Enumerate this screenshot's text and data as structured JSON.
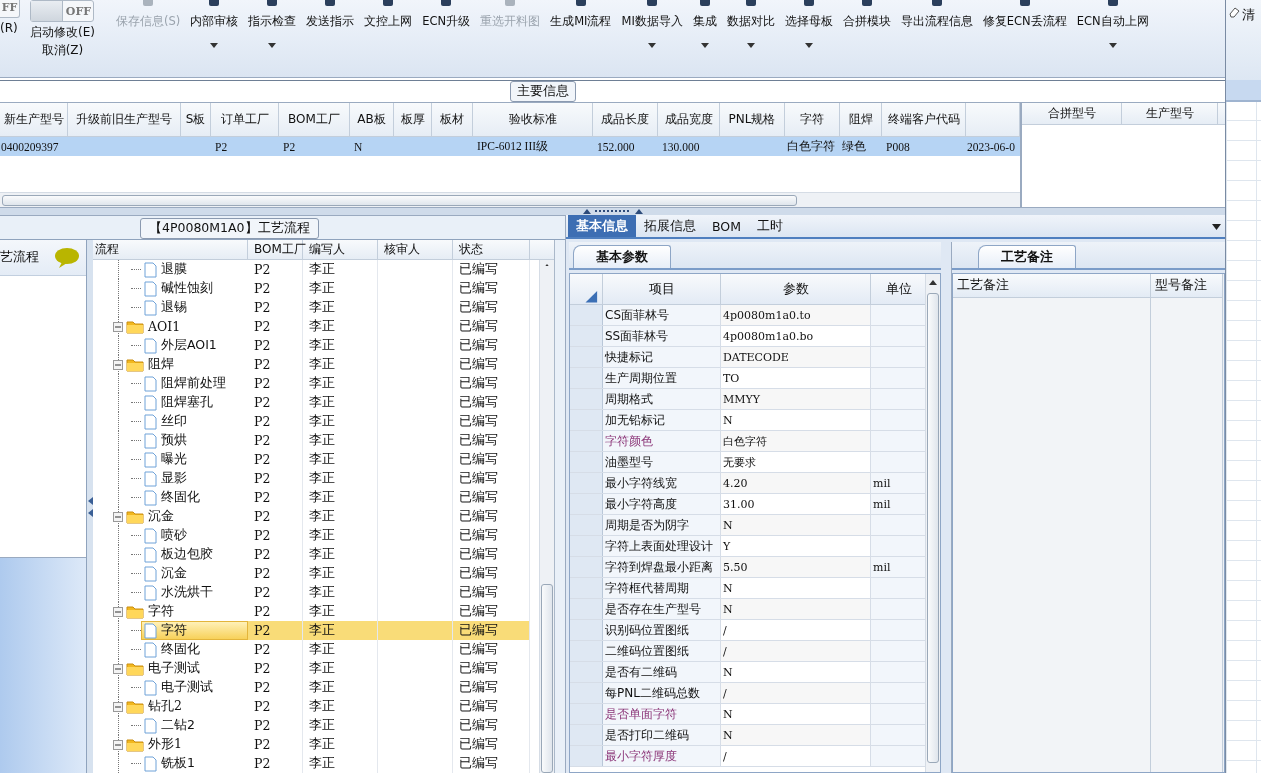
{
  "ribbon": {
    "toggles": [
      {
        "switch": "FF",
        "on": false,
        "labels": [
          "(R)"
        ]
      },
      {
        "switch": "OFF",
        "on": false,
        "labels": [
          "启动修改(E)",
          "取消(Z)"
        ]
      }
    ],
    "buttons": [
      {
        "label": "保存信息(S)",
        "disabled": true,
        "dropdown": false
      },
      {
        "label": "内部审核",
        "disabled": false,
        "dropdown": true
      },
      {
        "label": "指示检查",
        "disabled": false,
        "dropdown": true
      },
      {
        "label": "发送指示",
        "disabled": false,
        "dropdown": false
      },
      {
        "label": "文控上网",
        "disabled": false,
        "dropdown": false
      },
      {
        "label": "ECN升级",
        "disabled": false,
        "dropdown": false
      },
      {
        "label": "重选开料图",
        "disabled": true,
        "dropdown": false
      },
      {
        "label": "生成MI流程",
        "disabled": false,
        "dropdown": false
      },
      {
        "label": "MI数据导入",
        "disabled": false,
        "dropdown": true
      },
      {
        "label": "集成",
        "disabled": false,
        "dropdown": true
      },
      {
        "label": "数据对比",
        "disabled": false,
        "dropdown": true
      },
      {
        "label": "选择母板",
        "disabled": false,
        "dropdown": true
      },
      {
        "label": "合拼模块",
        "disabled": false,
        "dropdown": false
      },
      {
        "label": "导出流程信息",
        "disabled": false,
        "dropdown": false
      },
      {
        "label": "修复ECN丢流程",
        "disabled": false,
        "dropdown": false
      },
      {
        "label": "ECN自动上网",
        "disabled": false,
        "dropdown": true
      }
    ]
  },
  "side_strip": {
    "label": "清"
  },
  "main_info": {
    "title": "主要信息",
    "columns": [
      "新生产型号",
      "升级前旧生产型号",
      "S板",
      "订单工厂",
      "BOM工厂",
      "AB板",
      "板厚",
      "板材",
      "验收标准",
      "成品长度",
      "成品宽度",
      "PNL规格",
      "字符",
      "阻焊",
      "终端客户代码",
      null
    ],
    "rows": [
      {
        "selected": true,
        "cells": [
          "0400209397",
          null,
          null,
          "P2",
          "P2",
          "N",
          null,
          null,
          "IPC-6012 III级",
          "152.000",
          "130.000",
          null,
          "白色字符",
          "绿色",
          "P008",
          "2023-06-0"
        ]
      }
    ],
    "merge_table": {
      "columns": [
        "合拼型号",
        "生产型号"
      ]
    }
  },
  "process": {
    "title": "【4P0080M1A0】工艺流程",
    "sidebar": {
      "items": [
        {
          "label": "艺流程"
        }
      ]
    },
    "tree": {
      "columns": [
        "流程",
        "BOM工厂",
        "编写人",
        "核审人",
        "状态"
      ],
      "nodes": [
        {
          "children": [
            {
              "name": "退膜",
              "bom": "P2",
              "author": "李正",
              "status": "已编写",
              "selected": false
            },
            {
              "name": "碱性蚀刻",
              "bom": "P2",
              "author": "李正",
              "status": "已编写",
              "selected": false
            },
            {
              "name": "退锡",
              "bom": "P2",
              "author": "李正",
              "status": "已编写",
              "selected": false
            }
          ]
        },
        {
          "name": "AOI1",
          "bom": "P2",
          "author": "李正",
          "status": "已编写",
          "selected": false,
          "expanded": true,
          "children": [
            {
              "name": "外层AOI1",
              "bom": "P2",
              "author": "李正",
              "status": "已编写",
              "selected": false
            }
          ]
        },
        {
          "name": "阻焊",
          "bom": "P2",
          "author": "李正",
          "status": "已编写",
          "selected": false,
          "expanded": true,
          "children": [
            {
              "name": "阻焊前处理",
              "bom": "P2",
              "author": "李正",
              "status": "已编写",
              "selected": false
            },
            {
              "name": "阻焊塞孔",
              "bom": "P2",
              "author": "李正",
              "status": "已编写",
              "selected": false
            },
            {
              "name": "丝印",
              "bom": "P2",
              "author": "李正",
              "status": "已编写",
              "selected": false
            },
            {
              "name": "预烘",
              "bom": "P2",
              "author": "李正",
              "status": "已编写",
              "selected": false
            },
            {
              "name": "曝光",
              "bom": "P2",
              "author": "李正",
              "status": "已编写",
              "selected": false
            },
            {
              "name": "显影",
              "bom": "P2",
              "author": "李正",
              "status": "已编写",
              "selected": false
            },
            {
              "name": "终固化",
              "bom": "P2",
              "author": "李正",
              "status": "已编写",
              "selected": false
            }
          ]
        },
        {
          "name": "沉金",
          "bom": "P2",
          "author": "李正",
          "status": "已编写",
          "selected": false,
          "expanded": true,
          "children": [
            {
              "name": "喷砂",
              "bom": "P2",
              "author": "李正",
              "status": "已编写",
              "selected": false
            },
            {
              "name": "板边包胶",
              "bom": "P2",
              "author": "李正",
              "status": "已编写",
              "selected": false
            },
            {
              "name": "沉金",
              "bom": "P2",
              "author": "李正",
              "status": "已编写",
              "selected": false
            },
            {
              "name": "水洗烘干",
              "bom": "P2",
              "author": "李正",
              "status": "已编写",
              "selected": false
            }
          ]
        },
        {
          "name": "字符",
          "bom": "P2",
          "author": "李正",
          "status": "已编写",
          "selected": false,
          "expanded": true,
          "children": [
            {
              "name": "字符",
              "bom": "P2",
              "author": "李正",
              "status": "已编写",
              "selected": true
            },
            {
              "name": "终固化",
              "bom": "P2",
              "author": "李正",
              "status": "已编写",
              "selected": false
            }
          ]
        },
        {
          "name": "电子测试",
          "bom": "P2",
          "author": "李正",
          "status": "已编写",
          "selected": false,
          "expanded": true,
          "children": [
            {
              "name": "电子测试",
              "bom": "P2",
              "author": "李正",
              "status": "已编写",
              "selected": false
            }
          ]
        },
        {
          "name": "钻孔2",
          "bom": "P2",
          "author": "李正",
          "status": "已编写",
          "selected": false,
          "expanded": true,
          "children": [
            {
              "name": "二钻2",
              "bom": "P2",
              "author": "李正",
              "status": "已编写",
              "selected": false
            }
          ]
        },
        {
          "name": "外形1",
          "bom": "P2",
          "author": "李正",
          "status": "已编写",
          "selected": false,
          "expanded": true,
          "children": [
            {
              "name": "铣板1",
              "bom": "P2",
              "author": "李正",
              "status": "已编写",
              "selected": false
            }
          ]
        }
      ]
    }
  },
  "details": {
    "tabs": [
      {
        "label": "基本信息",
        "selected": true
      },
      {
        "label": "拓展信息",
        "selected": false
      },
      {
        "label": "BOM",
        "selected": false
      },
      {
        "label": "工时",
        "selected": false
      }
    ],
    "subtab": {
      "label": "基本参数",
      "selected": true
    },
    "params": {
      "columns": [
        "项目",
        "参数",
        "单位"
      ],
      "rows": [
        {
          "item": "CS面菲林号",
          "value": "4p0080m1a0.to",
          "marked": false
        },
        {
          "item": "SS面菲林号",
          "value": "4p0080m1a0.bo",
          "marked": false
        },
        {
          "item": "快捷标记",
          "value": "DATECODE",
          "marked": false
        },
        {
          "item": "生产周期位置",
          "value": "TO",
          "marked": false
        },
        {
          "item": "周期格式",
          "value": "MMYY",
          "marked": false
        },
        {
          "item": "加无铅标记",
          "value": "N",
          "marked": false
        },
        {
          "item": "字符颜色",
          "value": "白色字符",
          "marked": true
        },
        {
          "item": "油墨型号",
          "value": "无要求",
          "marked": false
        },
        {
          "item": "最小字符线宽",
          "value": "4.20",
          "unit": "mil",
          "marked": false
        },
        {
          "item": "最小字符高度",
          "value": "31.00",
          "unit": "mil",
          "marked": false
        },
        {
          "item": "周期是否为阴字",
          "value": "N",
          "marked": false
        },
        {
          "item": "字符上表面处理设计",
          "value": "Y",
          "marked": false
        },
        {
          "item": "字符到焊盘最小距离",
          "value": "5.50",
          "unit": "mil",
          "marked": false
        },
        {
          "item": "字符框代替周期",
          "value": "N",
          "marked": false
        },
        {
          "item": "是否存在生产型号",
          "value": "N",
          "marked": false
        },
        {
          "item": "识别码位置图纸",
          "value": "/",
          "marked": false
        },
        {
          "item": "二维码位置图纸",
          "value": "/",
          "marked": false
        },
        {
          "item": "是否有二维码",
          "value": "N",
          "marked": false
        },
        {
          "item": "每PNL二维码总数",
          "value": "/",
          "marked": false
        },
        {
          "item": "是否单面字符",
          "value": "N",
          "marked": true
        },
        {
          "item": "是否打印二维码",
          "value": "N",
          "marked": false
        },
        {
          "item": "最小字符厚度",
          "value": "/",
          "marked": true
        }
      ]
    },
    "notes": {
      "tab": "工艺备注",
      "columns": [
        "工艺备注",
        "型号备注"
      ]
    }
  }
}
